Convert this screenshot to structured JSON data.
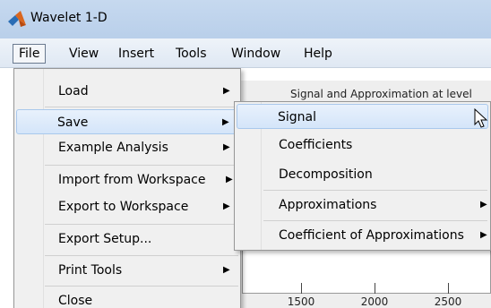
{
  "window": {
    "title": "Wavelet 1-D"
  },
  "menubar": {
    "items": [
      "File",
      "View",
      "Insert",
      "Tools",
      "Window",
      "Help"
    ]
  },
  "file_menu": {
    "items": [
      {
        "label": "Load",
        "submenu": true
      },
      {
        "label": "Save",
        "submenu": true
      },
      {
        "label": "Example Analysis",
        "submenu": true
      },
      {
        "label": "Import from Workspace",
        "submenu": true
      },
      {
        "label": "Export to Workspace",
        "submenu": true
      },
      {
        "label": "Export Setup...",
        "submenu": false
      },
      {
        "label": "Print Tools",
        "submenu": true
      },
      {
        "label": "Close",
        "submenu": false
      }
    ]
  },
  "save_menu": {
    "items": [
      {
        "label": "Signal",
        "submenu": false
      },
      {
        "label": "Coefficients",
        "submenu": false
      },
      {
        "label": "Decomposition",
        "submenu": false
      },
      {
        "label": "Approximations",
        "submenu": true
      },
      {
        "label": "Coefficient of Approximations",
        "submenu": true
      }
    ]
  },
  "plot": {
    "title": "Signal and Approximation at level",
    "x_ticks": [
      "1500",
      "2000",
      "2500"
    ]
  },
  "colors": {
    "accent": "#d4e5f9",
    "title_bar": "#c6d9ef"
  }
}
